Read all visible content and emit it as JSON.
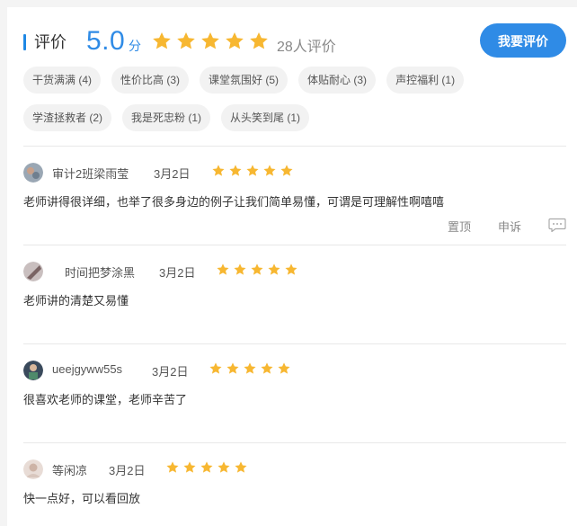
{
  "header": {
    "title": "评价",
    "score": "5.0",
    "score_unit": "分",
    "rating": 5,
    "review_count": "28人评价",
    "write_button": "我要评价"
  },
  "tags": [
    "干货满满 (4)",
    "性价比高 (3)",
    "课堂氛围好 (5)",
    "体贴耐心 (3)",
    "声控福利 (1)",
    "学渣拯救者 (2)",
    "我是死忠粉 (1)",
    "从头笑到尾 (1)"
  ],
  "reviews": [
    {
      "username": "审计2班梁雨莹",
      "date": "3月2日",
      "stars": 5,
      "content": "老师讲得很详细，也举了很多身边的例子让我们简单易懂，可谓是可理解性啊嘻嘻",
      "actions": {
        "top": "置顶",
        "report": "申诉"
      }
    },
    {
      "username": "时间把梦涂黑",
      "date": "3月2日",
      "stars": 5,
      "content": "老师讲的清楚又易懂"
    },
    {
      "username": "ueejgyww55s",
      "date": "3月2日",
      "stars": 5,
      "content": "很喜欢老师的课堂，老师辛苦了"
    },
    {
      "username": "等闲凉",
      "date": "3月2日",
      "stars": 5,
      "content": "快一点好，可以看回放"
    }
  ],
  "colors": {
    "accent": "#2f8be6",
    "star": "#f7b731",
    "tag_bg": "#f2f2f2"
  },
  "icons": {
    "star": "star-icon",
    "chat": "chat-bubble-icon"
  }
}
